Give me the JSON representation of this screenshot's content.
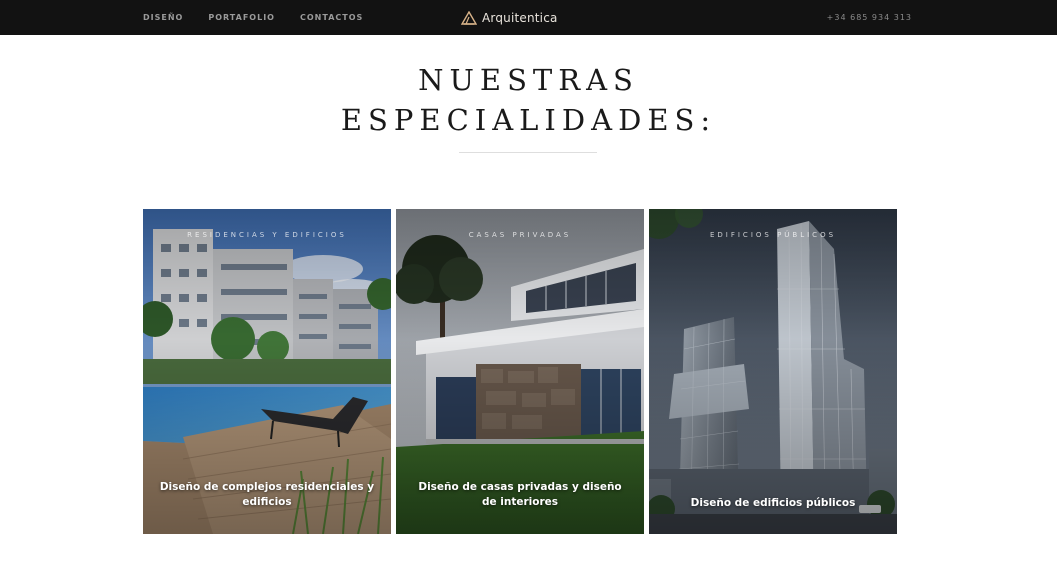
{
  "nav": {
    "links": [
      "DISEÑO",
      "PORTAFOLIO",
      "CONTACTOS"
    ],
    "logo_text": "Arquitentica",
    "phone": "+34 685 934 313"
  },
  "heading": {
    "line1": "NUESTRAS",
    "line2": "ESPECIALIDADES:"
  },
  "cards": [
    {
      "tag": "RESIDENCIAS Y EDIFICIOS",
      "caption": "Diseño de complejos residenciales y edificios"
    },
    {
      "tag": "CASAS PRIVADAS",
      "caption": "Diseño de casas privadas y diseño de interiores"
    },
    {
      "tag": "EDIFICIOS PÚBLICOS",
      "caption": "Diseño de edificios públicos"
    }
  ],
  "colors": {
    "topbar": "#121212",
    "logo_accent": "#d9b48a",
    "heading": "#1a1a1a"
  }
}
